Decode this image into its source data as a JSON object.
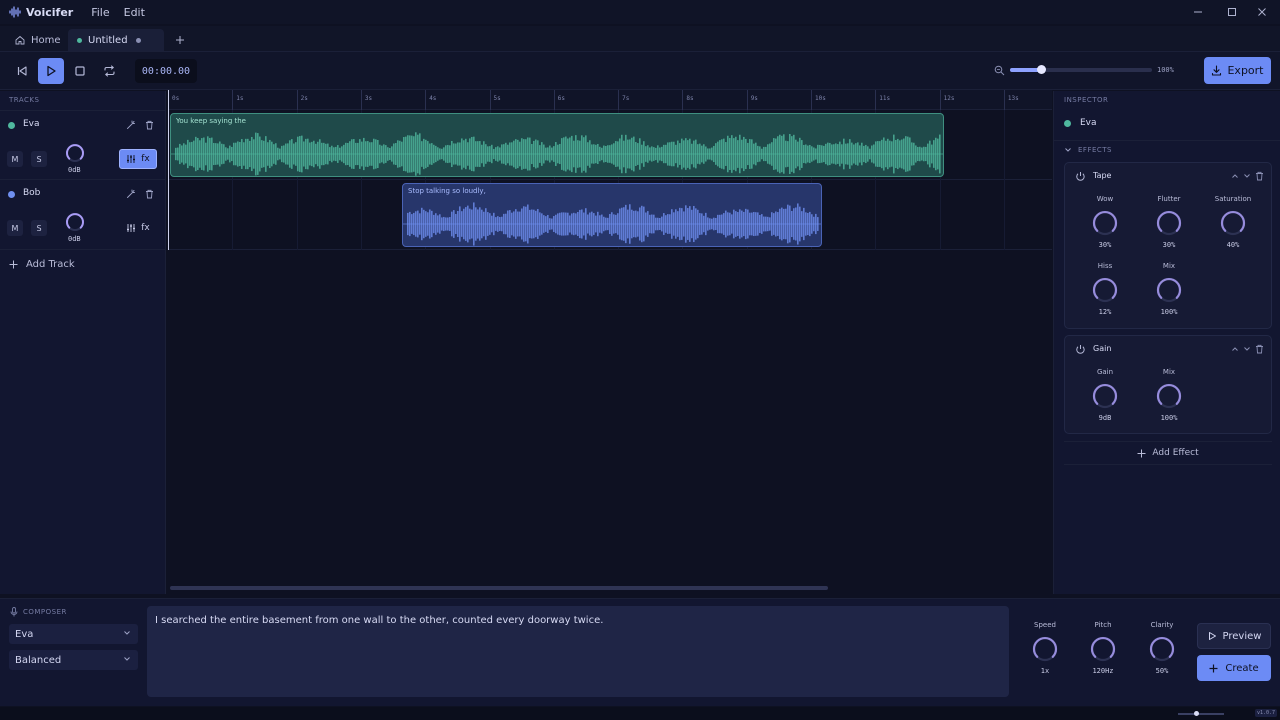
{
  "app": {
    "name": "Voicifer",
    "menu": [
      "File",
      "Edit"
    ]
  },
  "tabs": [
    {
      "label": "Home"
    },
    {
      "label": "Untitled"
    }
  ],
  "transport": {
    "timecode": "00:00.00",
    "zoom": "100%",
    "zoom_level": 0.22,
    "export_label": "Export"
  },
  "tracks": {
    "section_title": "TRACKS",
    "items": [
      {
        "name": "Eva",
        "color": "#4fb89e",
        "m": "M",
        "s": "S",
        "gain": "0dB",
        "fx": "fx"
      },
      {
        "name": "Bob",
        "color": "#6f8ff0",
        "m": "M",
        "s": "S",
        "gain": "0dB",
        "fx": "fx"
      }
    ],
    "add_label": "Add Track"
  },
  "ruler": [
    "0s",
    "1s",
    "2s",
    "3s",
    "4s",
    "5s",
    "6s",
    "7s",
    "8s",
    "9s",
    "10s",
    "11s",
    "12s",
    "13s"
  ],
  "clips": [
    {
      "label": "You keep saying the",
      "color": "#4fb89e"
    },
    {
      "label": "Stop talking so loudly,",
      "color": "#6f8ff0"
    }
  ],
  "inspector": {
    "title": "INSPECTOR",
    "track_name": "Eva",
    "track_color": "#4fb89e",
    "effects_title": "EFFECTS",
    "effects": [
      {
        "name": "Tape",
        "params": [
          {
            "label": "Wow",
            "value": "30%"
          },
          {
            "label": "Flutter",
            "value": "30%"
          },
          {
            "label": "Saturation",
            "value": "40%"
          },
          {
            "label": "Hiss",
            "value": "12%"
          },
          {
            "label": "Mix",
            "value": "100%"
          }
        ]
      },
      {
        "name": "Gain",
        "params": [
          {
            "label": "Gain",
            "value": "9dB"
          },
          {
            "label": "Mix",
            "value": "100%"
          }
        ]
      }
    ],
    "add_effect": "Add Effect"
  },
  "composer": {
    "title": "COMPOSER",
    "voice": "Eva",
    "style": "Balanced",
    "text": "I searched the entire basement from one wall to the other, counted every doorway twice.",
    "controls": [
      {
        "label": "Speed",
        "value": "1x"
      },
      {
        "label": "Pitch",
        "value": "120Hz"
      },
      {
        "label": "Clarity",
        "value": "50%"
      }
    ],
    "preview_label": "Preview",
    "create_label": "Create"
  },
  "statusbar": {
    "version": "v1.0.7"
  },
  "colors": {
    "accent": "#6c8bf5",
    "bg": "#0e1122",
    "panel": "#121630"
  }
}
